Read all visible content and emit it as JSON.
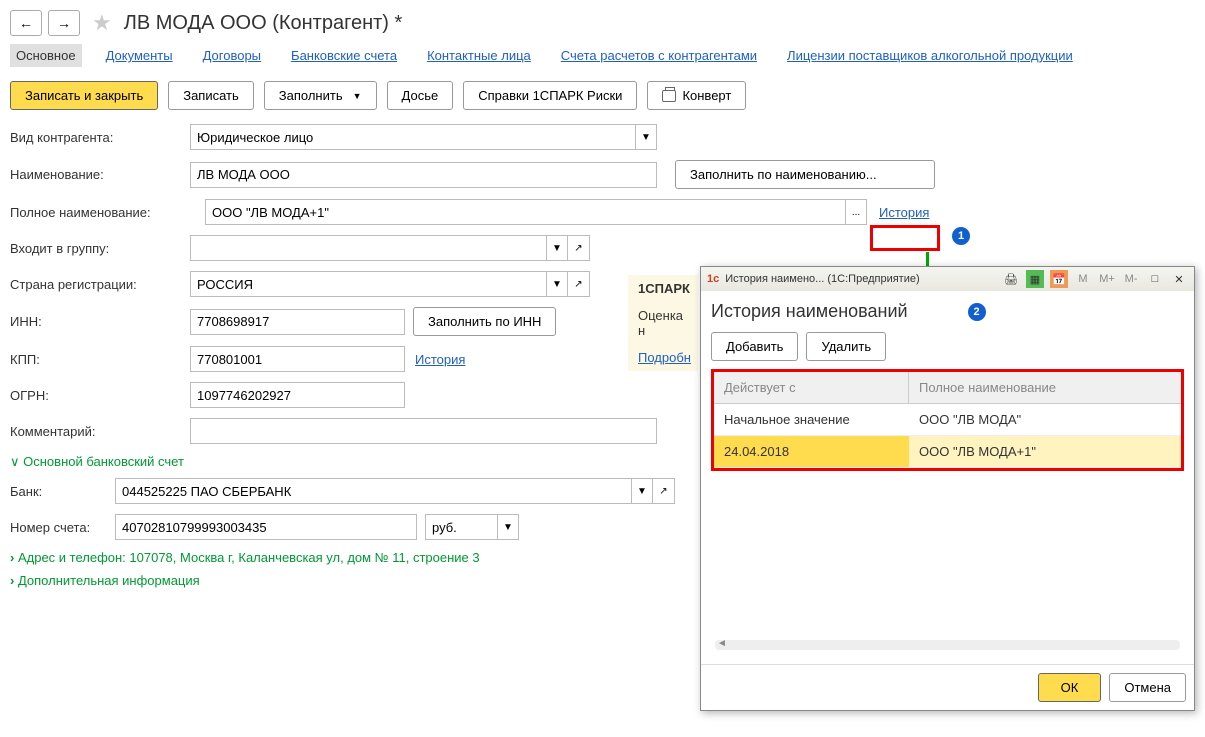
{
  "page_title": "ЛВ МОДА ООО (Контрагент) *",
  "tabs": [
    "Основное",
    "Документы",
    "Договоры",
    "Банковские счета",
    "Контактные лица",
    "Счета расчетов с контрагентами",
    "Лицензии поставщиков алкогольной продукции"
  ],
  "toolbar": {
    "save_close": "Записать и закрыть",
    "save": "Записать",
    "fill": "Заполнить",
    "dossier": "Досье",
    "spark": "Справки 1СПАРК Риски",
    "convert": "Конверт"
  },
  "form": {
    "type_label": "Вид контрагента:",
    "type_value": "Юридическое лицо",
    "name_label": "Наименование:",
    "name_value": "ЛВ МОДА ООО",
    "fill_by_name": "Заполнить по наименованию...",
    "full_name_label": "Полное наименование:",
    "full_name_value": "ООО \"ЛВ МОДА+1\"",
    "history_link": "История",
    "group_label": "Входит в группу:",
    "group_value": "",
    "country_label": "Страна регистрации:",
    "country_value": "РОССИЯ",
    "inn_label": "ИНН:",
    "inn_value": "7708698917",
    "fill_by_inn": "Заполнить по ИНН",
    "kpp_label": "КПП:",
    "kpp_value": "770801001",
    "ogrn_label": "ОГРН:",
    "ogrn_value": "1097746202927",
    "comment_label": "Комментарий:",
    "comment_value": ""
  },
  "bank_section": {
    "title": "Основной банковский счет",
    "bank_label": "Банк:",
    "bank_value": "044525225 ПАО СБЕРБАНК",
    "account_label": "Номер счета:",
    "account_value": "40702810799993003435",
    "currency": "руб."
  },
  "collapsible": {
    "address": "Адрес и телефон: 107078, Москва г, Каланчевская ул, дом № 11, строение 3",
    "additional": "Дополнительная информация"
  },
  "side": {
    "spark": "1СПАРК",
    "rating": "Оценка н",
    "more": "Подробн"
  },
  "callouts": {
    "one": "1",
    "two": "2"
  },
  "popup": {
    "window_title": "История наимено... (1С:Предприятие)",
    "heading": "История наименований",
    "add": "Добавить",
    "delete": "Удалить",
    "col1": "Действует с",
    "col2": "Полное наименование",
    "rows": [
      {
        "date": "Начальное значение",
        "name": "ООО \"ЛВ МОДА\""
      },
      {
        "date": "24.04.2018",
        "name": "ООО \"ЛВ МОДА+1\""
      }
    ],
    "ok": "ОК",
    "cancel": "Отмена",
    "m_buttons": [
      "M",
      "M+",
      "M-"
    ]
  }
}
